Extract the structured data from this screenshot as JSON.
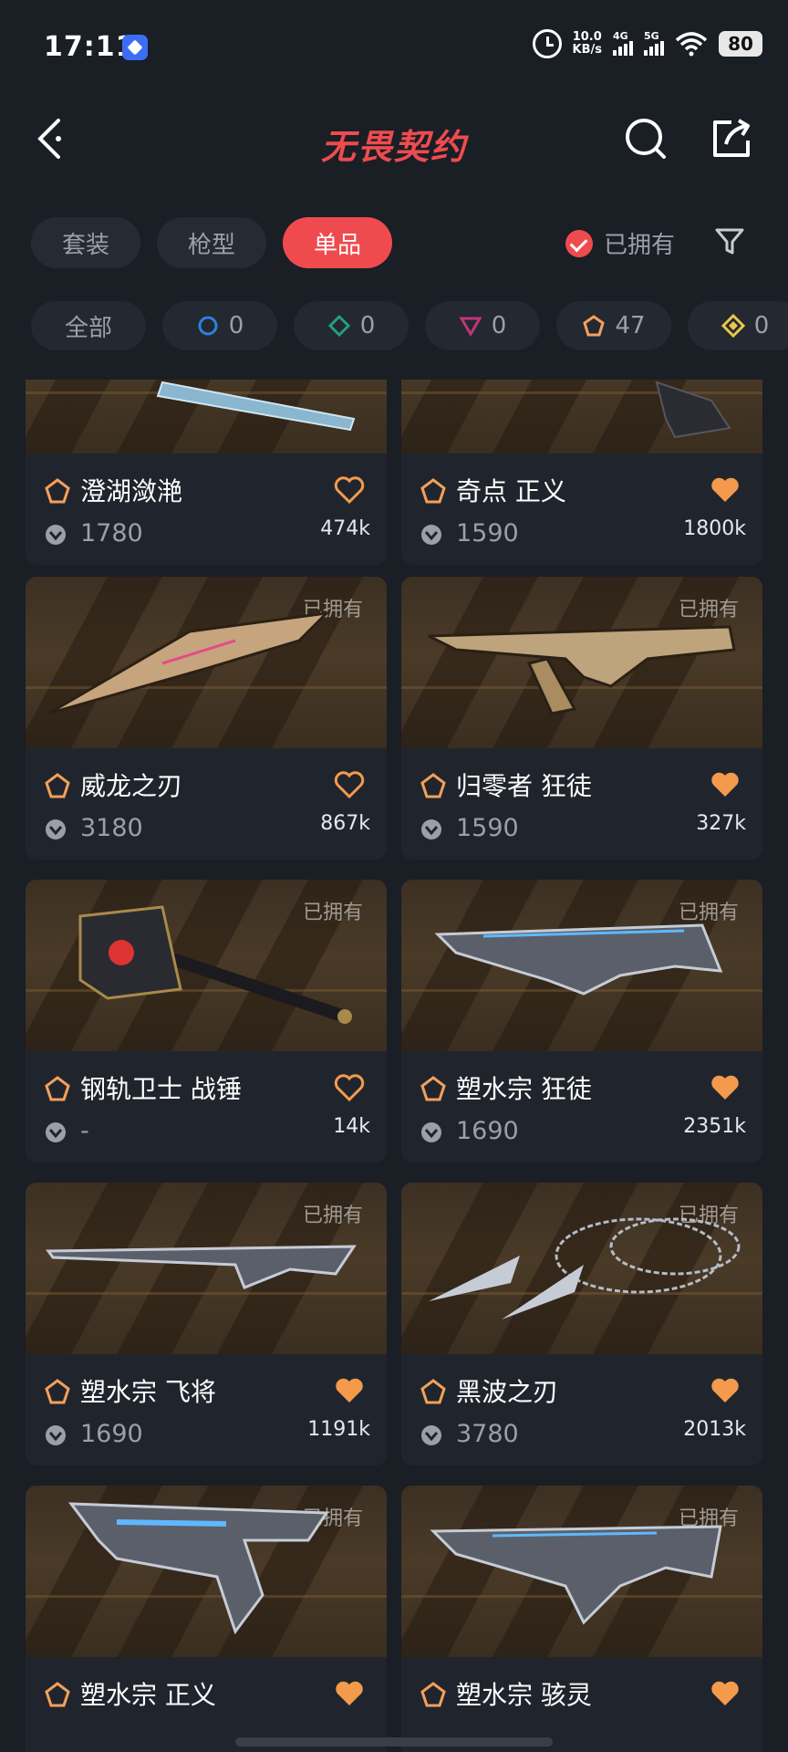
{
  "status_bar": {
    "time": "17:11",
    "net_speed_value": "10.0",
    "net_speed_unit": "KB/s",
    "sim1": "4G",
    "sim2": "5G",
    "battery": "80"
  },
  "header": {
    "title": "无畏契约"
  },
  "tabs": [
    {
      "label": "套装",
      "active": false
    },
    {
      "label": "枪型",
      "active": false
    },
    {
      "label": "单品",
      "active": true
    }
  ],
  "owned_filter": {
    "label": "已拥有",
    "checked": true
  },
  "rarity_chips": [
    {
      "label": "全部",
      "count": null
    },
    {
      "label": "",
      "count": "0",
      "color": "#2f7fe0",
      "shape": "circle"
    },
    {
      "label": "",
      "count": "0",
      "color": "#22a07a",
      "shape": "diamond"
    },
    {
      "label": "",
      "count": "0",
      "color": "#c0357a",
      "shape": "triangle"
    },
    {
      "label": "",
      "count": "47",
      "color": "#f3a05a",
      "shape": "pentagon"
    },
    {
      "label": "",
      "count": "0",
      "color": "#e8c84a",
      "shape": "diamond-gold"
    }
  ],
  "owned_tag": "已拥有",
  "items": [
    {
      "name": "澄湖潋滟",
      "price": "1780",
      "likes": "474k",
      "liked": false,
      "owned": false,
      "weapon": "knife-blue"
    },
    {
      "name": "奇点 正义",
      "price": "1590",
      "likes": "1800k",
      "liked": true,
      "owned": false,
      "weapon": "pistol-dark"
    },
    {
      "name": "威龙之刃",
      "price": "3180",
      "likes": "867k",
      "liked": false,
      "owned": true,
      "weapon": "knife-gold"
    },
    {
      "name": "归零者 狂徒",
      "price": "1590",
      "likes": "327k",
      "liked": true,
      "owned": true,
      "weapon": "rifle-gold"
    },
    {
      "name": "钢轨卫士 战锤",
      "price": "-",
      "likes": "14k",
      "liked": false,
      "owned": true,
      "weapon": "hammer"
    },
    {
      "name": "塑水宗 狂徒",
      "price": "1690",
      "likes": "2351k",
      "liked": true,
      "owned": true,
      "weapon": "rifle-silver"
    },
    {
      "name": "塑水宗 飞将",
      "price": "1690",
      "likes": "1191k",
      "liked": true,
      "owned": true,
      "weapon": "sniper-silver"
    },
    {
      "name": "黑波之刃",
      "price": "3780",
      "likes": "2013k",
      "liked": true,
      "owned": true,
      "weapon": "kunai-chain"
    },
    {
      "name": "塑水宗 正义",
      "price": "",
      "likes": "",
      "liked": true,
      "owned": true,
      "weapon": "pistol-silver"
    },
    {
      "name": "塑水宗 骇灵",
      "price": "",
      "likes": "",
      "liked": true,
      "owned": true,
      "weapon": "smg-silver"
    }
  ],
  "colors": {
    "accent": "#ef4b4f",
    "heart": "#f39a4c",
    "rank_exclusive": "#f3a05a",
    "background": "#1a1e25",
    "card": "#20252d"
  }
}
